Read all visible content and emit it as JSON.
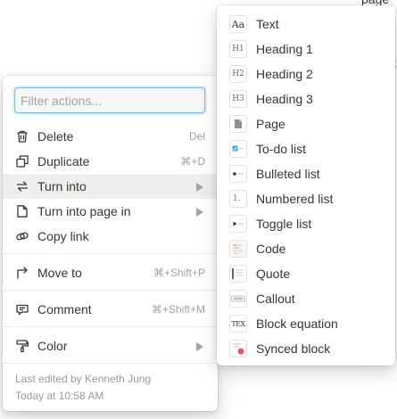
{
  "background": {
    "fragment_top": "page",
    "fragment_right": "t"
  },
  "actions_menu": {
    "filter": {
      "placeholder": "Filter actions...",
      "value": ""
    },
    "items": [
      {
        "label": "Delete",
        "shortcut": "Del",
        "icon": "trash-icon"
      },
      {
        "label": "Duplicate",
        "shortcut": "⌘+D",
        "icon": "duplicate-icon"
      },
      {
        "label": "Turn into",
        "shortcut": "",
        "icon": "turn-into-icon",
        "submenu": true,
        "active": true
      },
      {
        "label": "Turn into page in",
        "shortcut": "",
        "icon": "page-icon",
        "submenu": true
      },
      {
        "label": "Copy link",
        "shortcut": "",
        "icon": "link-icon"
      },
      {
        "label": "Move to",
        "shortcut": "⌘+Shift+P",
        "icon": "move-arrow-icon"
      },
      {
        "label": "Comment",
        "shortcut": "⌘+Shift+M",
        "icon": "comment-icon"
      },
      {
        "label": "Color",
        "shortcut": "",
        "icon": "paint-roller-icon",
        "submenu": true
      }
    ],
    "footer": {
      "edited_by": "Last edited by Kenneth Jung",
      "edited_at": "Today at 10:58 AM"
    }
  },
  "turn_into_menu": {
    "items": [
      {
        "label": "Text",
        "icon": "text-block-icon",
        "glyph": "Aa"
      },
      {
        "label": "Heading 1",
        "icon": "heading-1-icon",
        "glyph": "H1"
      },
      {
        "label": "Heading 2",
        "icon": "heading-2-icon",
        "glyph": "H2"
      },
      {
        "label": "Heading 3",
        "icon": "heading-3-icon",
        "glyph": "H3"
      },
      {
        "label": "Page",
        "icon": "page-block-icon",
        "glyph": ""
      },
      {
        "label": "To-do list",
        "icon": "todo-block-icon",
        "glyph": ""
      },
      {
        "label": "Bulleted list",
        "icon": "bulleted-list-icon",
        "glyph": ""
      },
      {
        "label": "Numbered list",
        "icon": "numbered-list-icon",
        "glyph": "1."
      },
      {
        "label": "Toggle list",
        "icon": "toggle-list-icon",
        "glyph": ""
      },
      {
        "label": "Code",
        "icon": "code-block-icon",
        "glyph": ""
      },
      {
        "label": "Quote",
        "icon": "quote-block-icon",
        "glyph": ""
      },
      {
        "label": "Callout",
        "icon": "callout-block-icon",
        "glyph": ""
      },
      {
        "label": "Block equation",
        "icon": "equation-block-icon",
        "glyph": "TEX"
      },
      {
        "label": "Synced block",
        "icon": "synced-block-icon",
        "glyph": ""
      }
    ]
  },
  "colors": {
    "text": "#37352f",
    "muted": "#a3a29f",
    "active_row": "#eeeeed",
    "focus_ring": "#7fb5d9",
    "todo_check": "#2eaadc",
    "synced_dot": "#eb5757"
  }
}
